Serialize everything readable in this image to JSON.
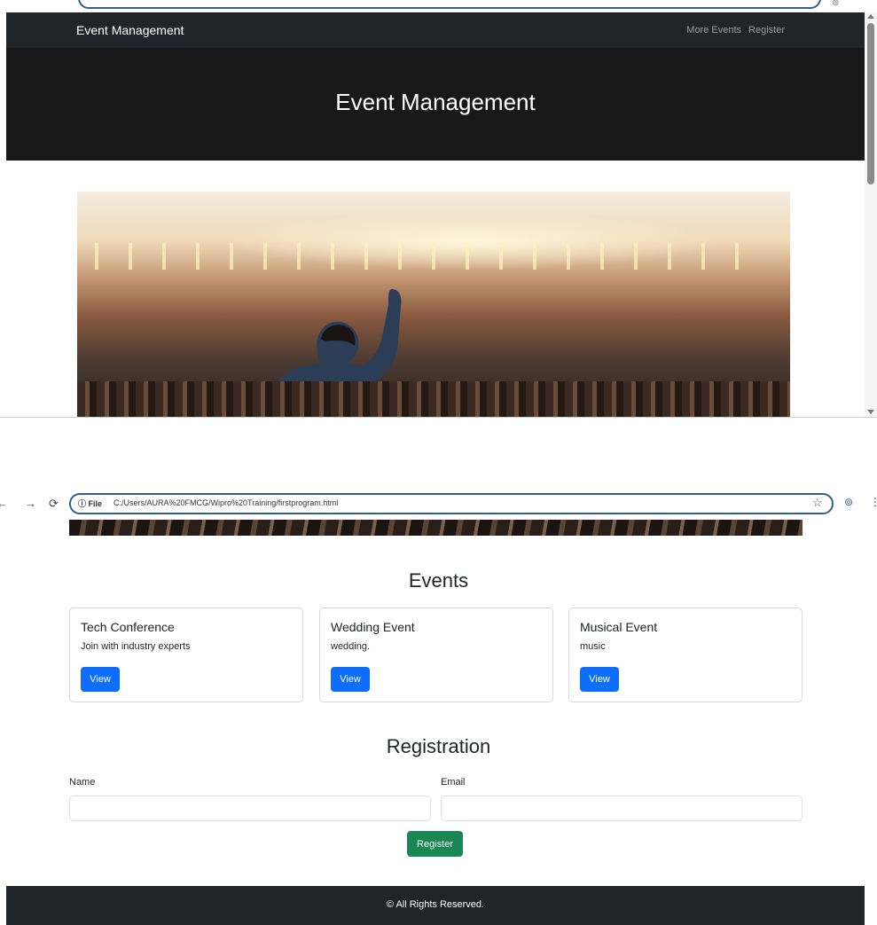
{
  "navbar": {
    "brand": "Event Management",
    "links": [
      "More Events",
      "Register"
    ]
  },
  "hero": {
    "title": "Event Management"
  },
  "browser": {
    "site_info": "File",
    "url": "C:/Users/AURA%20FMCG/Wipro%20Training/firstprogram.html"
  },
  "events": {
    "heading": "Events",
    "cards": [
      {
        "title": "Tech Conference",
        "text": "Join with industry experts",
        "button": "View"
      },
      {
        "title": "Wedding Event",
        "text": "wedding.",
        "button": "View"
      },
      {
        "title": "Musical Event",
        "text": "music",
        "button": "View"
      }
    ]
  },
  "registration": {
    "heading": "Registration",
    "name_label": "Name",
    "name_value": "",
    "email_label": "Email",
    "email_value": "",
    "submit": "Register"
  },
  "footer": {
    "text": "© All Rights Reserved."
  },
  "colors": {
    "navbar_bg": "#212529",
    "hero_bg": "#181818",
    "primary_button": "#0d6efd",
    "success_button": "#198754",
    "urlbar_border": "#2f5f8a"
  },
  "icons": {
    "back": "←",
    "forward": "→",
    "reload": "⟳",
    "info": "ⓘ",
    "star": "☆",
    "profile": "⊚",
    "menu": "⋮"
  }
}
